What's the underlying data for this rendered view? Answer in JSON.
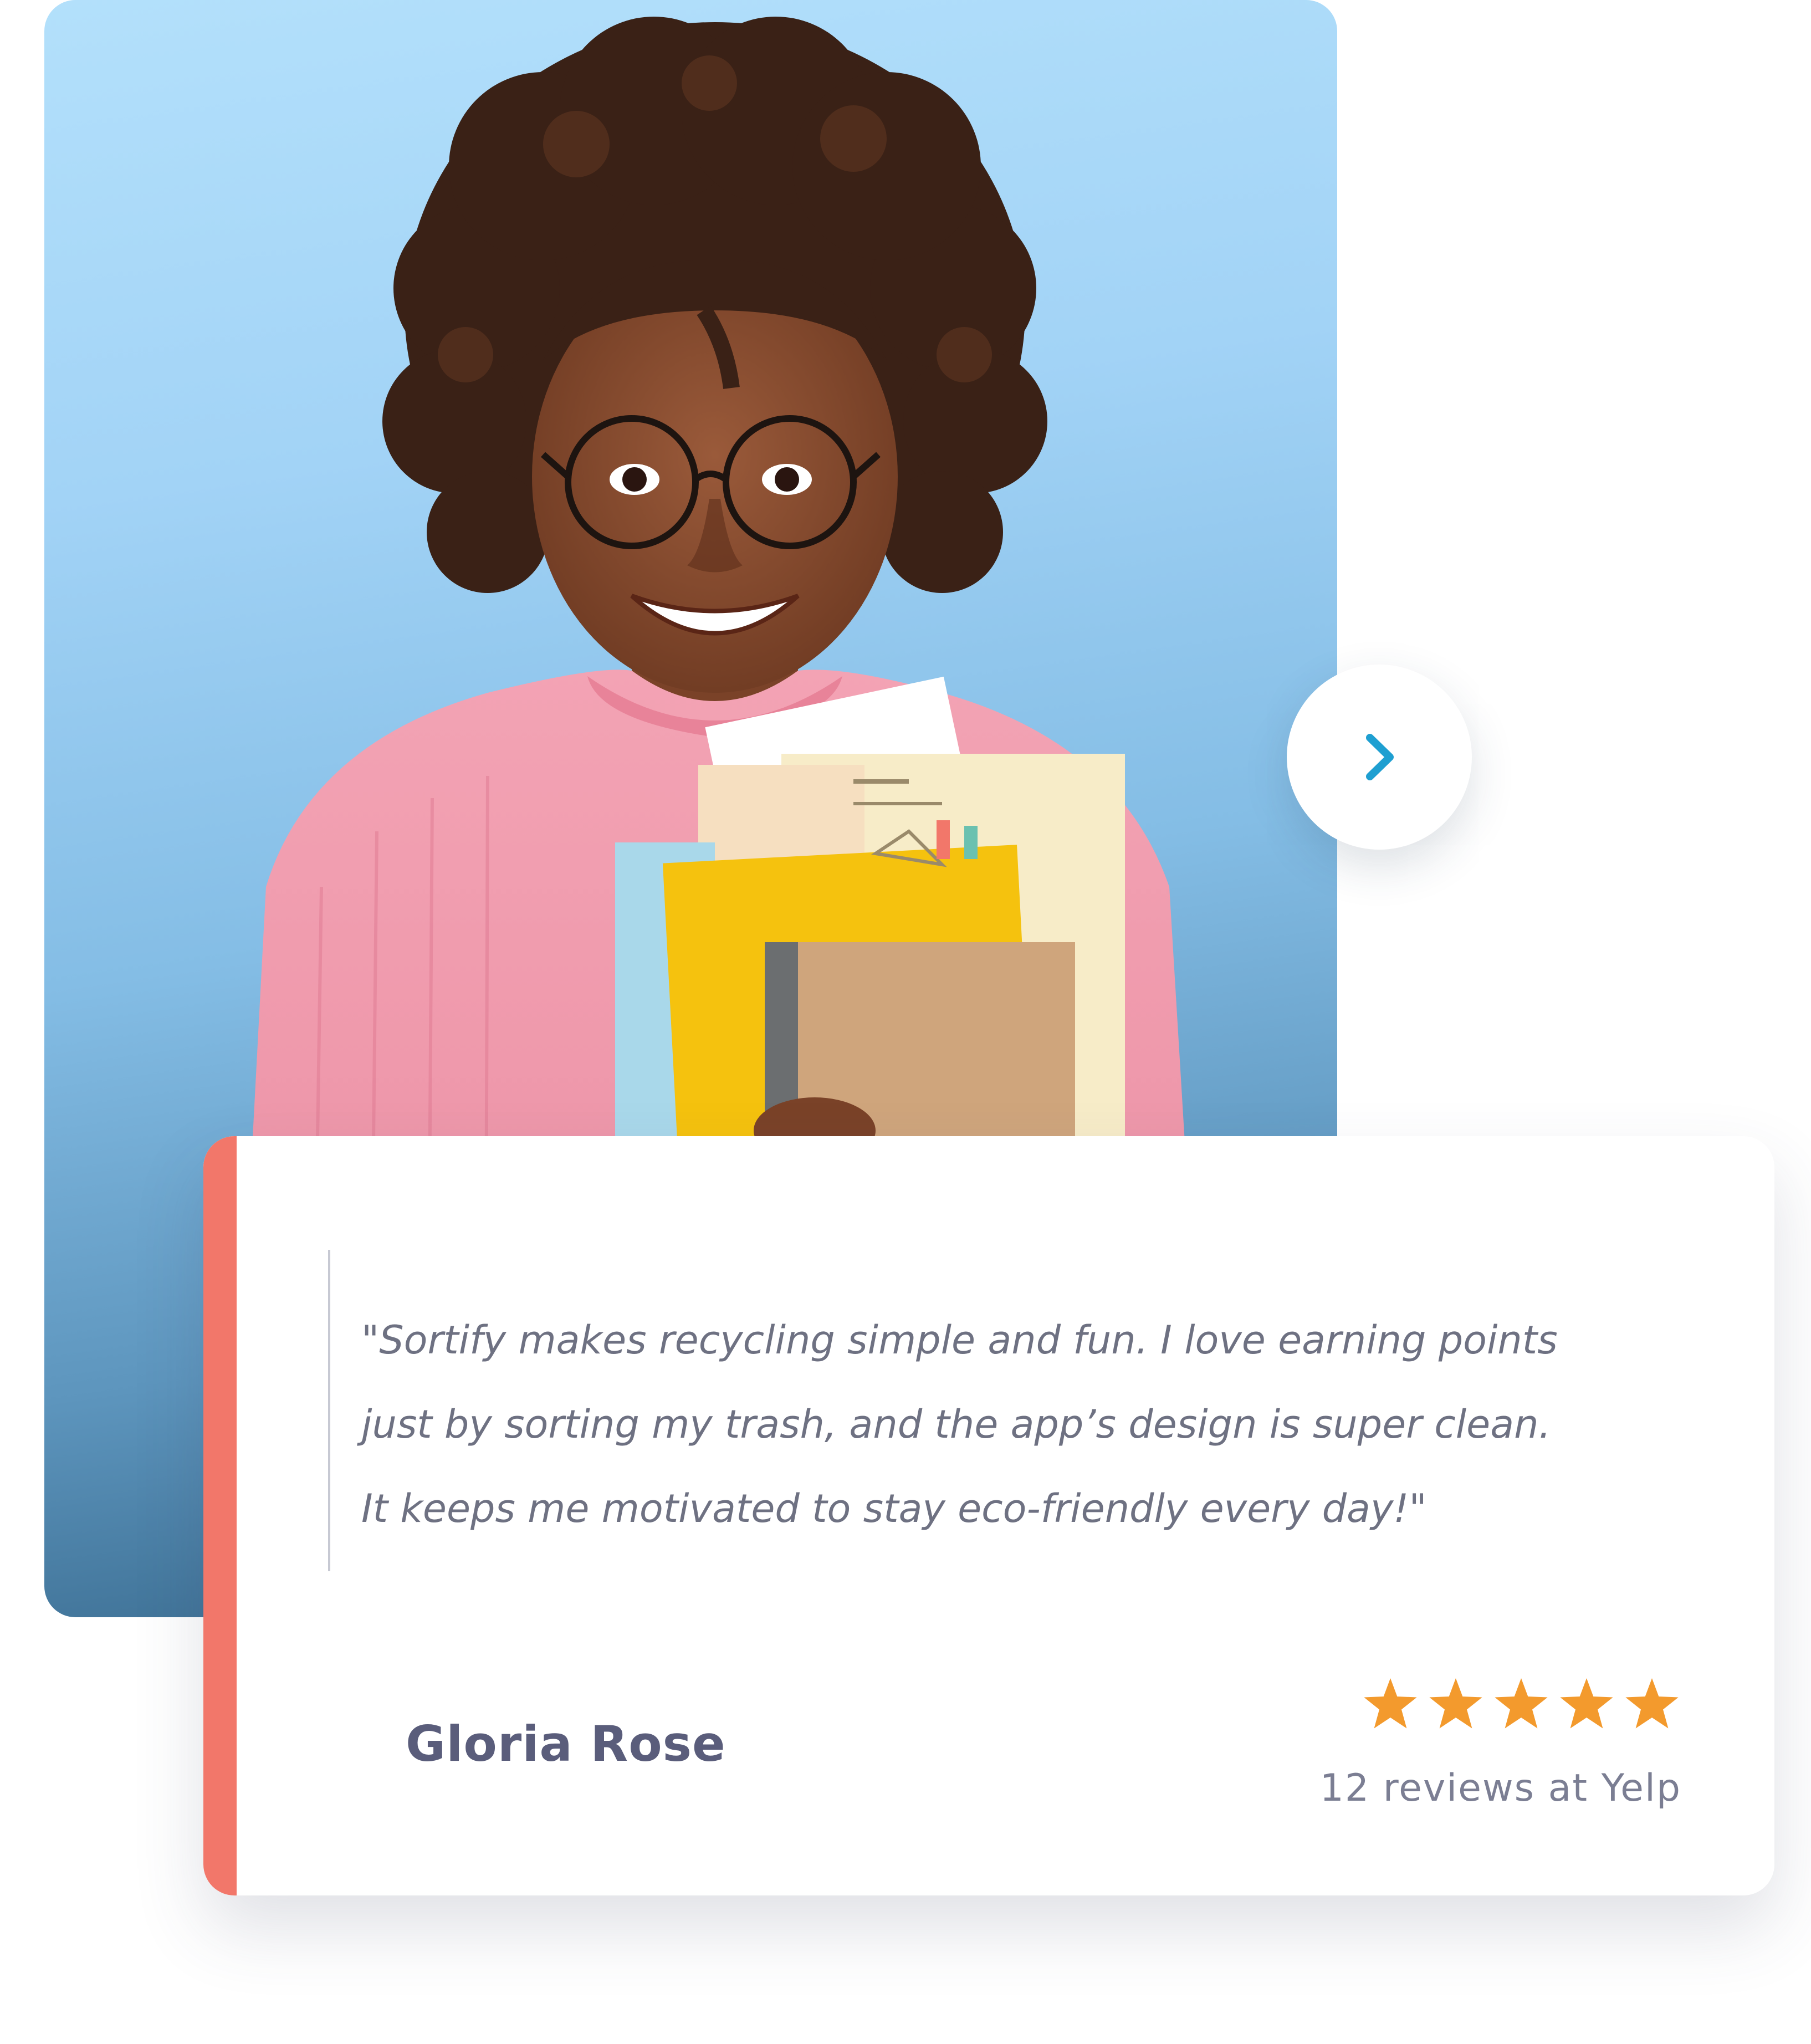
{
  "testimonial": {
    "quote_lines": [
      "\"Sortify makes recycling simple and fun. I love earning points",
      "just by sorting my trash, and the app’s design is super clean.",
      "It keeps me motivated to stay eco-friendly every day!\""
    ],
    "author_name": "Gloria Rose",
    "rating": 5,
    "rating_max": 5,
    "review_count_text": "12 reviews at Yelp"
  },
  "navigation": {
    "next_icon": "chevron-right-icon"
  },
  "colors": {
    "accent_coral": "#f2776a",
    "star_orange": "#f39a2d",
    "chevron_blue": "#1e9fd1",
    "photo_bg_top": "#b3e0fb",
    "photo_bg_bottom": "#2f5f82"
  }
}
